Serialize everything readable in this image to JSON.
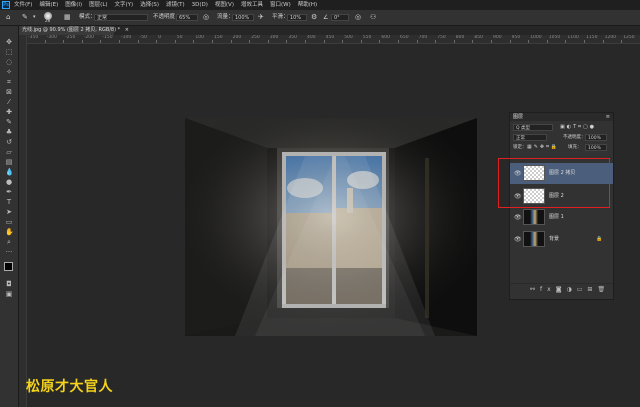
{
  "app": {
    "logo_text": "Ps"
  },
  "menubar": {
    "items": [
      "文件(F)",
      "编辑(E)",
      "图像(I)",
      "图层(L)",
      "文字(Y)",
      "选择(S)",
      "滤镜(T)",
      "3D(D)",
      "视图(V)",
      "增效工具",
      "窗口(W)",
      "帮助(H)"
    ]
  },
  "options": {
    "brush_size": "28",
    "mode_label": "模式：",
    "mode_value": "正常",
    "opacity_label": "不透明度：",
    "opacity_value": "65%",
    "flow_label": "流量：",
    "flow_value": "100%",
    "smooth_label": "平滑：",
    "smooth_value": "10%",
    "angle_value": "0°"
  },
  "document_tab": {
    "title": "光线.jpg @ 90.9% (图层 2 拷贝, RGB/8) *",
    "close": "×"
  },
  "ruler": {
    "h_ticks": [
      "-350",
      "-300",
      "-250",
      "-200",
      "-150",
      "-100",
      "-50",
      "0",
      "50",
      "100",
      "150",
      "200",
      "250",
      "300",
      "350",
      "400",
      "450",
      "500",
      "550",
      "600",
      "650",
      "700",
      "750",
      "800",
      "850",
      "900",
      "950",
      "1000",
      "1050",
      "1100",
      "1150",
      "1200",
      "1250"
    ]
  },
  "layers_panel": {
    "title": "图层",
    "filter_label": "Q 类型",
    "blend_mode": "正常",
    "opacity_label": "不透明度：",
    "opacity_value": "100%",
    "lock_label": "锁定：",
    "fill_label": "填充：",
    "fill_value": "100%",
    "layers": [
      {
        "name": "图层 2 拷贝",
        "thumb": "transparent",
        "selected": true
      },
      {
        "name": "图层 2",
        "thumb": "transparent",
        "selected": false
      },
      {
        "name": "图层 1",
        "thumb": "photo",
        "selected": false
      },
      {
        "name": "背景",
        "thumb": "photo",
        "selected": false,
        "locked": true
      }
    ]
  },
  "watermark": "松原才大官人",
  "colors": {
    "accent": "#31a8ff",
    "highlight": "#e02020",
    "watermark": "#f4d21c",
    "selected_layer": "#4b5f7c"
  }
}
